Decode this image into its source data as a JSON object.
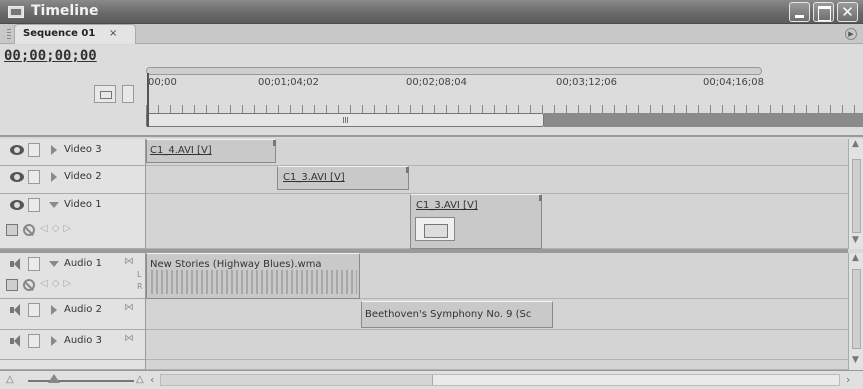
{
  "window": {
    "title": "Timeline"
  },
  "tab": {
    "label": "Sequence 01",
    "close": "×"
  },
  "header": {
    "timecode": "00;00;00;00",
    "ruler_labels": [
      "00;00",
      "00;01;04;02",
      "00;02;08;04",
      "00;03;12;06",
      "00;04;16;08"
    ]
  },
  "video_tracks": [
    {
      "name": "Video 3",
      "clips": [
        {
          "name": "C1_4.AVI [V]"
        }
      ]
    },
    {
      "name": "Video 2",
      "clips": [
        {
          "name": "C1_3.AVI [V]"
        }
      ]
    },
    {
      "name": "Video 1",
      "clips": [
        {
          "name": "C1_3.AVI [V]"
        }
      ]
    }
  ],
  "audio_tracks": [
    {
      "name": "Audio 1",
      "clips": [
        {
          "name": "New Stories (Highway Blues).wma"
        }
      ],
      "channels": [
        "L",
        "R"
      ]
    },
    {
      "name": "Audio 2",
      "clips": [
        {
          "name": "Beethoven's Symphony No. 9 (Sc"
        }
      ]
    },
    {
      "name": "Audio 3",
      "clips": []
    }
  ],
  "icons": {
    "eye": "eye-icon",
    "speaker": "speaker-icon",
    "lock": "lock-icon",
    "disclosure": "triangle-icon",
    "mute": "mute-icon"
  }
}
